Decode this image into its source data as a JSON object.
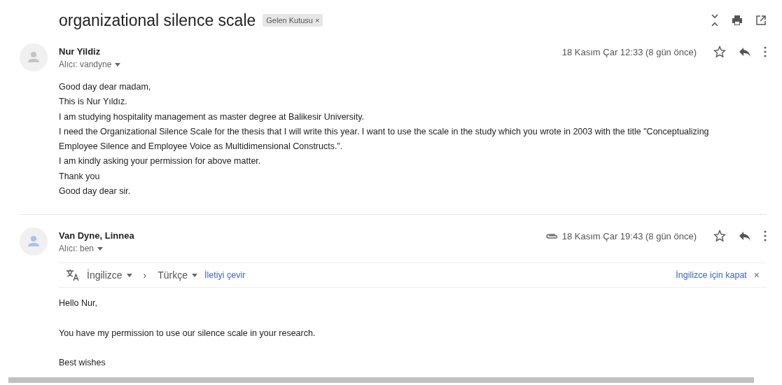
{
  "subject": "organizational silence scale",
  "label": {
    "text": "Gelen Kutusu",
    "close": "×"
  },
  "messages": [
    {
      "sender": "Nur Yildiz",
      "recipient": "Alıcı: vandyne",
      "date": "18 Kasım Çar 12:33 (8 gün önce)",
      "attachment": false,
      "starred": false,
      "color": "#c4c4c4",
      "body": [
        "Good day dear madam,",
        "This is Nur Yıldız.",
        "I am studying  hospitality management as master degree at Balikesir University.",
        "I need the Organizational Silence Scale for the thesis that I will write this year.  I want to use the scale in the study which you wrote in 2003 with the title \"Conceptualizing Employee Silence and Employee Voice as Multidimensional Constructs.\".",
        "I am kindly asking your permission for above matter.",
        "Thank you",
        "Good day dear sir."
      ],
      "kind": "lines"
    },
    {
      "sender": "Van Dyne, Linnea",
      "recipient": "Alıcı: ben",
      "date": "18 Kasım Çar 19:43 (8 gün önce)",
      "attachment": true,
      "starred": false,
      "color": "#a8c2ee",
      "translate": {
        "from": "İngilizce",
        "arrow": "›",
        "to": "Türkçe",
        "action": "İletiyi çevir",
        "close_text": "İngilizce için kapat",
        "close": "×"
      },
      "body": [
        "Hello Nur,",
        "You have my permission to use our silence scale in your research.",
        "Best wishes"
      ],
      "kind": "paragraphs"
    }
  ]
}
